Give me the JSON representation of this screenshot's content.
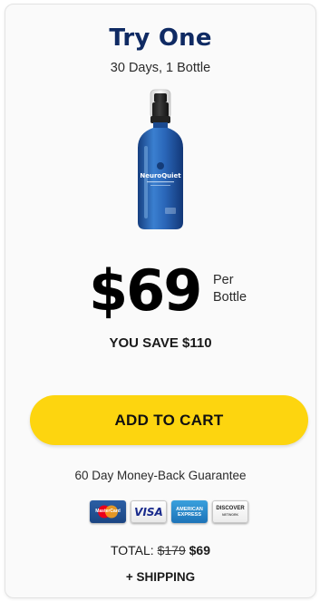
{
  "offer": {
    "title": "Try One",
    "subtitle": "30 Days, 1 Bottle",
    "product_label": "NeuroQuiet",
    "price": "$69",
    "per_line1": "Per",
    "per_line2": "Bottle",
    "savings": "YOU SAVE $110",
    "cta_label": "ADD TO CART",
    "guarantee": "60 Day Money-Back Guarantee",
    "total_label": "TOTAL:",
    "total_old": "$179",
    "total_new": "$69",
    "shipping": "+ SHIPPING"
  },
  "payment_cards": {
    "mastercard": "MasterCard",
    "visa": "VISA",
    "amex_line1": "AMERICAN",
    "amex_line2": "EXPRESS",
    "discover": "DISCOVER",
    "discover_sub": "NETWORK"
  },
  "colors": {
    "title": "#0f2a63",
    "cta_background": "#fdd50f",
    "bottle_blue": "#2f6fc0"
  }
}
